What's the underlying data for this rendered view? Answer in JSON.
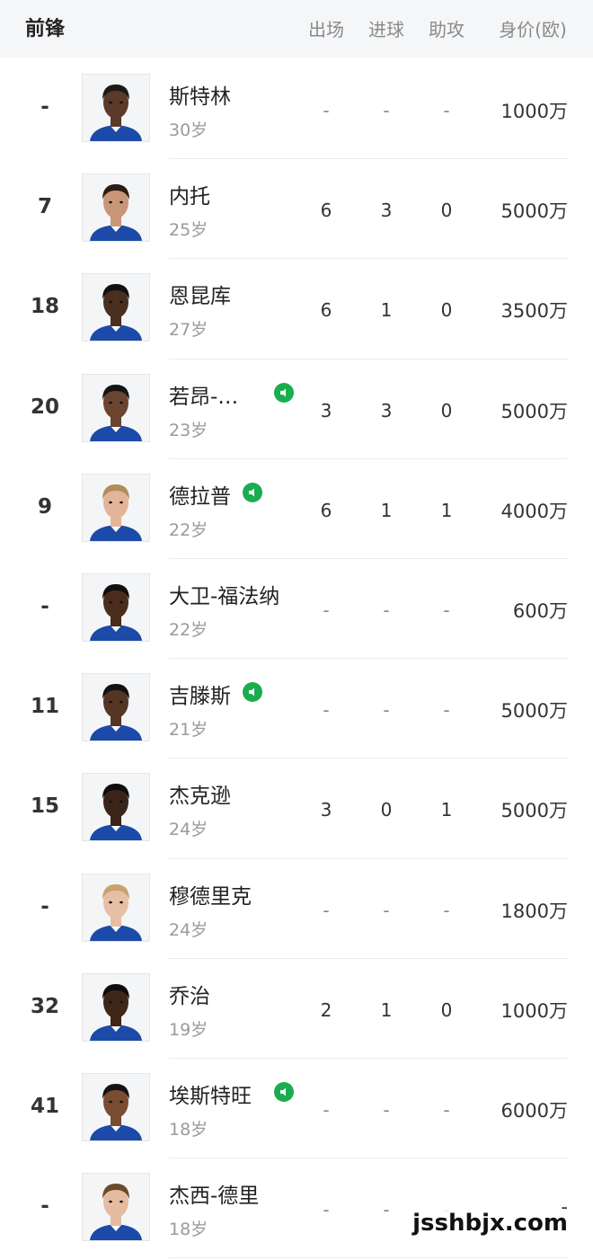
{
  "header": {
    "title": "前锋",
    "columns": [
      "出场",
      "进球",
      "助攻",
      "身价(欧)"
    ]
  },
  "players": [
    {
      "number": "-",
      "name": "斯特林",
      "age": "30岁",
      "apps": "-",
      "goals": "-",
      "assists": "-",
      "value": "1000万",
      "badge": false,
      "skin": "#5a3a28",
      "hair": "#1a1a1a"
    },
    {
      "number": "7",
      "name": "内托",
      "age": "25岁",
      "apps": "6",
      "goals": "3",
      "assists": "0",
      "value": "5000万",
      "badge": false,
      "skin": "#c99677",
      "hair": "#2a1d15"
    },
    {
      "number": "18",
      "name": "恩昆库",
      "age": "27岁",
      "apps": "6",
      "goals": "1",
      "assists": "0",
      "value": "3500万",
      "badge": false,
      "skin": "#4a2e1f",
      "hair": "#111111"
    },
    {
      "number": "20",
      "name": "若昂-…",
      "age": "23岁",
      "apps": "3",
      "goals": "3",
      "assists": "0",
      "value": "5000万",
      "badge": true,
      "skin": "#6b4530",
      "hair": "#151515"
    },
    {
      "number": "9",
      "name": "德拉普",
      "age": "22岁",
      "apps": "6",
      "goals": "1",
      "assists": "1",
      "value": "4000万",
      "badge": true,
      "skin": "#e2b59a",
      "hair": "#b38b58"
    },
    {
      "number": "-",
      "name": "大卫-福法纳",
      "age": "22岁",
      "apps": "-",
      "goals": "-",
      "assists": "-",
      "value": "600万",
      "badge": false,
      "skin": "#4a2d1d",
      "hair": "#101010"
    },
    {
      "number": "11",
      "name": "吉滕斯",
      "age": "21岁",
      "apps": "-",
      "goals": "-",
      "assists": "-",
      "value": "5000万",
      "badge": true,
      "skin": "#553524",
      "hair": "#121212"
    },
    {
      "number": "15",
      "name": "杰克逊",
      "age": "24岁",
      "apps": "3",
      "goals": "0",
      "assists": "1",
      "value": "5000万",
      "badge": false,
      "skin": "#3b2418",
      "hair": "#0d0d0d"
    },
    {
      "number": "-",
      "name": "穆德里克",
      "age": "24岁",
      "apps": "-",
      "goals": "-",
      "assists": "-",
      "value": "1800万",
      "badge": false,
      "skin": "#e6bfa6",
      "hair": "#caa36c"
    },
    {
      "number": "32",
      "name": "乔治",
      "age": "19岁",
      "apps": "2",
      "goals": "1",
      "assists": "0",
      "value": "1000万",
      "badge": false,
      "skin": "#3e2619",
      "hair": "#0d0d0d"
    },
    {
      "number": "41",
      "name": "埃斯特旺",
      "age": "18岁",
      "apps": "-",
      "goals": "-",
      "assists": "-",
      "value": "6000万",
      "badge": true,
      "skin": "#7a4c32",
      "hair": "#141414"
    },
    {
      "number": "-",
      "name": "杰西-德里",
      "age": "18岁",
      "apps": "-",
      "goals": "-",
      "assists": "-",
      "value": "-",
      "badge": false,
      "skin": "#e4bca1",
      "hair": "#6b4a2c"
    }
  ],
  "watermark": "jsshbjx.com",
  "colors": {
    "badge": "#1aad4f",
    "kit": "#1c4aa8",
    "header_bg": "#f5f6f8"
  }
}
